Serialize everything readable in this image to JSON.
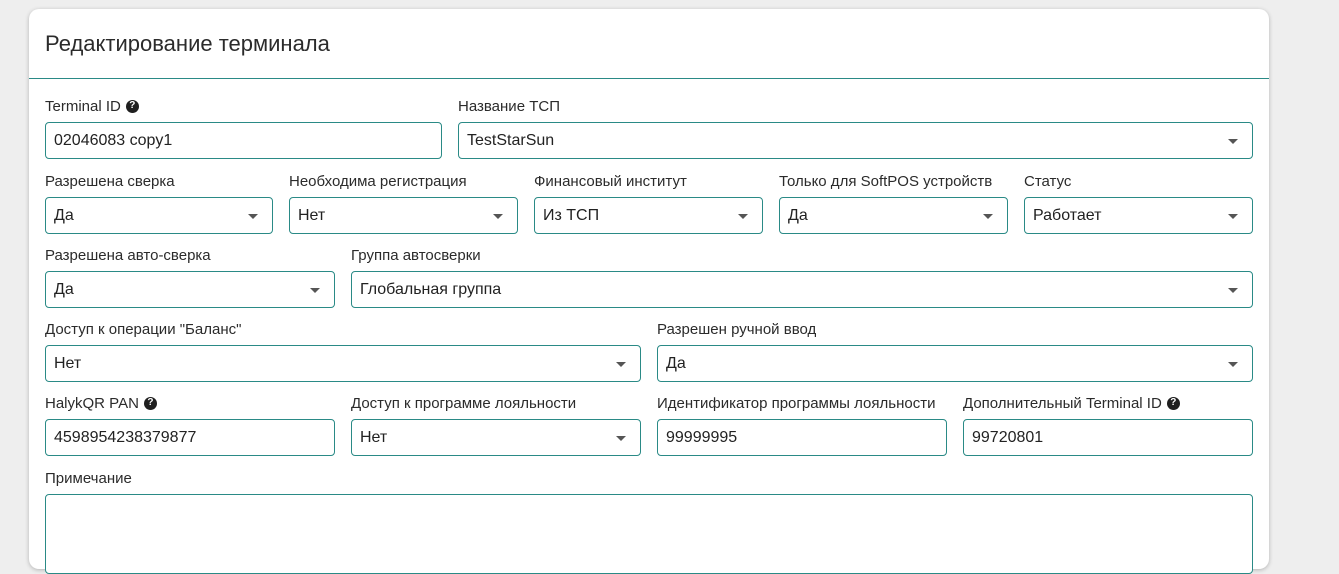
{
  "header": {
    "title": "Редактирование терминала"
  },
  "fields": {
    "terminal_id": {
      "label": "Terminal ID",
      "value": "02046083 copy1"
    },
    "tsp_name": {
      "label": "Название ТСП",
      "value": "TestStarSun"
    },
    "reconciliation": {
      "label": "Разрешена сверка",
      "value": "Да"
    },
    "registration": {
      "label": "Необходима регистрация",
      "value": "Нет"
    },
    "fin_institute": {
      "label": "Финансовый институт",
      "value": "Из ТСП"
    },
    "softpos_only": {
      "label": "Только для SoftPOS устройств",
      "value": "Да"
    },
    "status": {
      "label": "Статус",
      "value": "Работает"
    },
    "auto_reconciliation": {
      "label": "Разрешена авто-сверка",
      "value": "Да"
    },
    "auto_group": {
      "label": "Группа автосверки",
      "value": "Глобальная группа"
    },
    "balance_access": {
      "label": "Доступ к операции \"Баланс\"",
      "value": "Нет"
    },
    "manual_input": {
      "label": "Разрешен ручной ввод",
      "value": "Да"
    },
    "halykqr_pan": {
      "label": "HalykQR PAN",
      "value": "4598954238379877"
    },
    "loyalty_access": {
      "label": "Доступ к программе лояльности",
      "value": "Нет"
    },
    "loyalty_id": {
      "label": "Идентификатор программы лояльности",
      "value": "99999995"
    },
    "extra_terminal_id": {
      "label": "Дополнительный Terminal ID",
      "value": "99720801"
    },
    "note": {
      "label": "Примечание",
      "value": ""
    }
  },
  "help_glyph": "?",
  "colors": {
    "border_accent": "#2a8a86",
    "background": "#eeeeee",
    "card": "#ffffff"
  }
}
